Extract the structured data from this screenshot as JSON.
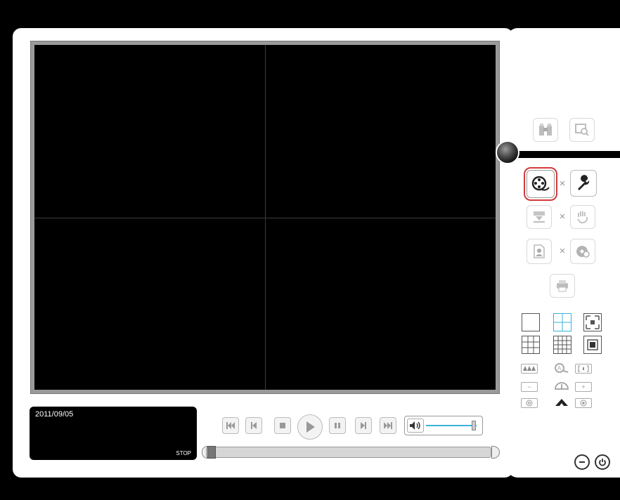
{
  "viewer": {
    "split_layout": "quad",
    "channel_count": 4
  },
  "info": {
    "date": "2011/09/05",
    "status": "STOP"
  },
  "side": {
    "top_buttons": [
      {
        "icon": "binoculars-icon"
      },
      {
        "icon": "screen-search-icon"
      }
    ],
    "function_buttons": [
      {
        "icon": "film-reel-icon",
        "selected": true
      },
      {
        "icon": "wrench-icon"
      },
      {
        "icon": "download-icon"
      },
      {
        "icon": "hand-icon"
      },
      {
        "icon": "user-document-icon"
      },
      {
        "icon": "disc-icon"
      },
      {
        "icon": "printer-icon"
      }
    ],
    "layout_buttons": [
      "single-view-icon",
      "quad-view-icon",
      "fullscreen-icon",
      "nine-view-icon",
      "sixteen-view-icon",
      "fit-screen-icon"
    ],
    "small_labels": {
      "minus": "−",
      "plus": "+"
    }
  },
  "playback": {
    "buttons": [
      "skip-start-icon",
      "step-back-icon",
      "stop-icon",
      "play-icon",
      "pause-icon",
      "step-forward-icon",
      "skip-end-icon"
    ],
    "volume_level": 0.95,
    "progress": 0.0
  },
  "colors": {
    "accent_line": "#3ab3d8",
    "selected_outline": "#d23a3a",
    "video_bg": "#000000"
  }
}
